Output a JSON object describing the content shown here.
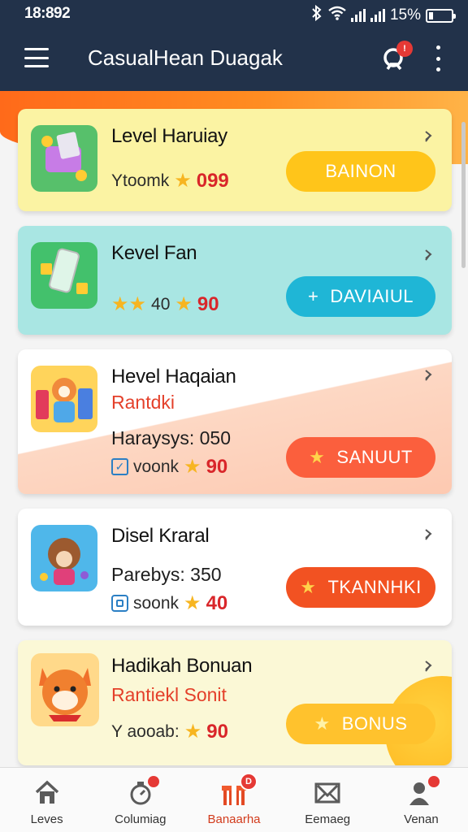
{
  "status_bar": {
    "time": "18:892",
    "battery": "15%",
    "battery_level": 0.15
  },
  "app_bar": {
    "title": "CasualHean Duagak",
    "notification_badge": "!"
  },
  "cards": [
    {
      "title": "Level Haruiay",
      "meta_text": "Ytoomk",
      "meta_value": "099",
      "button_label": "BAINON",
      "bg": "#fbf3a3",
      "button_color": "#ffc51a",
      "thumb_color": "#57c06b"
    },
    {
      "title": "Kevel Fan",
      "meta_text": "40",
      "meta_value": "90",
      "button_label": "DAVIAIUL",
      "button_icon": "+",
      "bg": "#a9e6e3",
      "button_color": "#1fb6d6",
      "thumb_color": "#43c16c"
    },
    {
      "title": "Hevel Haqaian",
      "subtitle": "Rantdki",
      "stat": "Haraysys: 050",
      "meta_text": "voonk",
      "meta_value": "90",
      "button_label": "SANUUT",
      "bg": "#fdd8c4",
      "button_color": "#fb5f3d",
      "thumb_color": "#ffd45b"
    },
    {
      "title": "Disel Kraral",
      "stat": "Parebys: 350",
      "meta_text": "soonk",
      "meta_value": "40",
      "button_label": "TKANNHKI",
      "bg": "#ffffff",
      "button_color": "#f25222",
      "thumb_color": "#4fb7ea"
    },
    {
      "title": "Hadikah Bonuan",
      "subtitle": "Rantiekl Sonit",
      "meta_text": "Y aooab:",
      "meta_value": "90",
      "button_label": "BONUS",
      "bg": "#fbf8d6",
      "button_color": "#ffc22d",
      "thumb_color": "#ffd98a"
    }
  ],
  "bottom_nav": [
    {
      "label": "Leves",
      "icon": "home-icon"
    },
    {
      "label": "Columiag",
      "icon": "timer-icon"
    },
    {
      "label": "Banaarha",
      "icon": "gift-icon",
      "badge": "D"
    },
    {
      "label": "Eemaeg",
      "icon": "mail-icon"
    },
    {
      "label": "Venan",
      "icon": "profile-icon"
    }
  ],
  "colors": {
    "header": "#22324a",
    "accent": "#ff7a1f",
    "badge": "#e53935"
  }
}
